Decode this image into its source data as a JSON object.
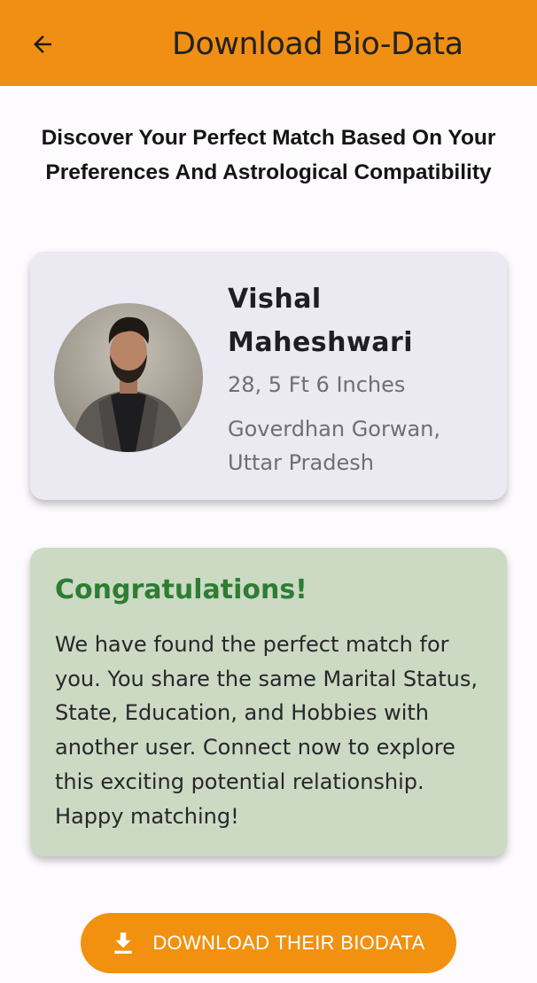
{
  "appbar": {
    "title": "Download Bio-Data",
    "back_icon": "arrow-back-icon"
  },
  "headline": "Discover Your Perfect Match Based On Your Preferences And Astrological Compatibility",
  "profile": {
    "name": "Vishal Maheshwari",
    "age_height": "28, 5 Ft 6 Inches",
    "location": "Goverdhan Gorwan, Uttar Pradesh"
  },
  "congrats": {
    "title": "Congratulations!",
    "body": "We have found the perfect match for you. You share the same Marital Status, State, Education, and Hobbies with another user. Connect now to explore this exciting potential relationship. Happy matching!"
  },
  "download": {
    "label": "DOWNLOAD THEIR BIODATA",
    "icon": "download-icon"
  },
  "colors": {
    "accent": "#f18f14",
    "profile_card_bg": "#ebe9f2",
    "congrats_bg": "#ccd9c3",
    "congrats_title": "#2e7d32"
  }
}
